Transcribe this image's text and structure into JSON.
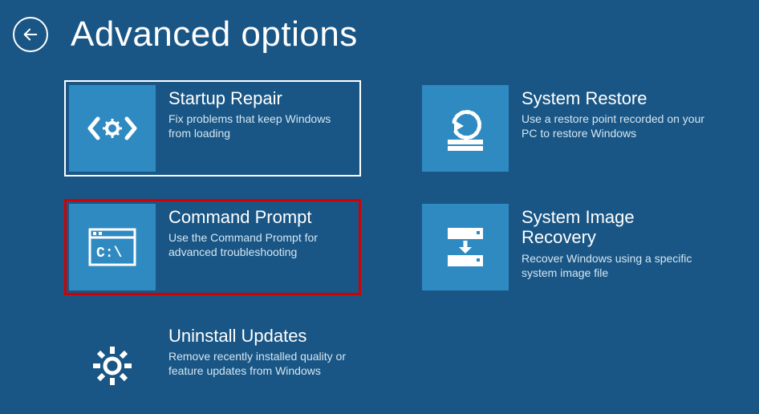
{
  "header": {
    "title": "Advanced options"
  },
  "tiles": {
    "startup_repair": {
      "title": "Startup Repair",
      "desc": "Fix problems that keep Windows from loading"
    },
    "system_restore": {
      "title": "System Restore",
      "desc": "Use a restore point recorded on your PC to restore Windows"
    },
    "command_prompt": {
      "title": "Command Prompt",
      "desc": "Use the Command Prompt for advanced troubleshooting"
    },
    "system_image_recovery": {
      "title": "System Image Recovery",
      "desc": "Recover Windows using a specific system image file"
    },
    "uninstall_updates": {
      "title": "Uninstall Updates",
      "desc": "Remove recently installed quality or feature updates from Windows"
    }
  }
}
